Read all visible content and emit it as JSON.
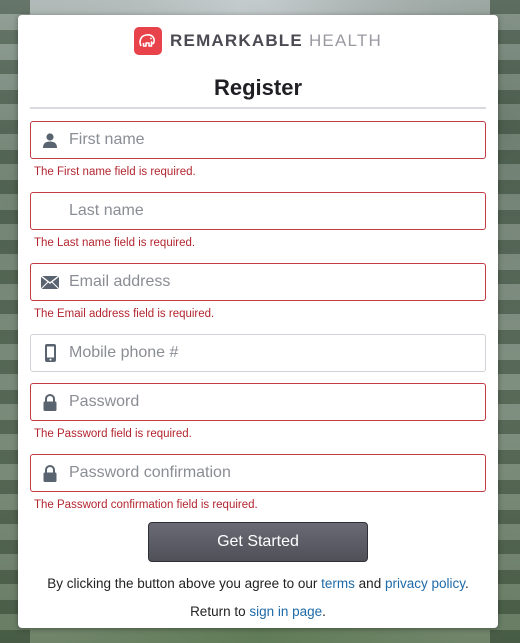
{
  "brand": {
    "name_strong": "REMARKABLE",
    "name_light": "HEALTH",
    "accent": "#e8424a"
  },
  "title": "Register",
  "fields": [
    {
      "placeholder": "First name",
      "value": "",
      "error": "The First name field is required."
    },
    {
      "placeholder": "Last name",
      "value": "",
      "error": "The Last name field is required."
    },
    {
      "placeholder": "Email address",
      "value": "",
      "error": "The Email address field is required."
    },
    {
      "placeholder": "Mobile phone #",
      "value": "",
      "error": ""
    },
    {
      "placeholder": "Password",
      "value": "",
      "error": "The Password field is required."
    },
    {
      "placeholder": "Password confirmation",
      "value": "",
      "error": "The Password confirmation field is required."
    }
  ],
  "button_label": "Get Started",
  "agree": {
    "prefix": "By clicking the button above you agree to our",
    "terms": "terms",
    "and": "and",
    "privacy": "privacy policy",
    "suffix": "."
  },
  "return_text": {
    "prefix": "Return to",
    "link": "sign in page",
    "suffix": "."
  },
  "colors": {
    "error": "#b3262f",
    "link": "#1e6aa8",
    "button": "#5a5a63"
  },
  "icons": [
    "user-icon",
    "",
    "envelope-icon",
    "phone-icon",
    "lock-icon",
    "lock-icon"
  ]
}
